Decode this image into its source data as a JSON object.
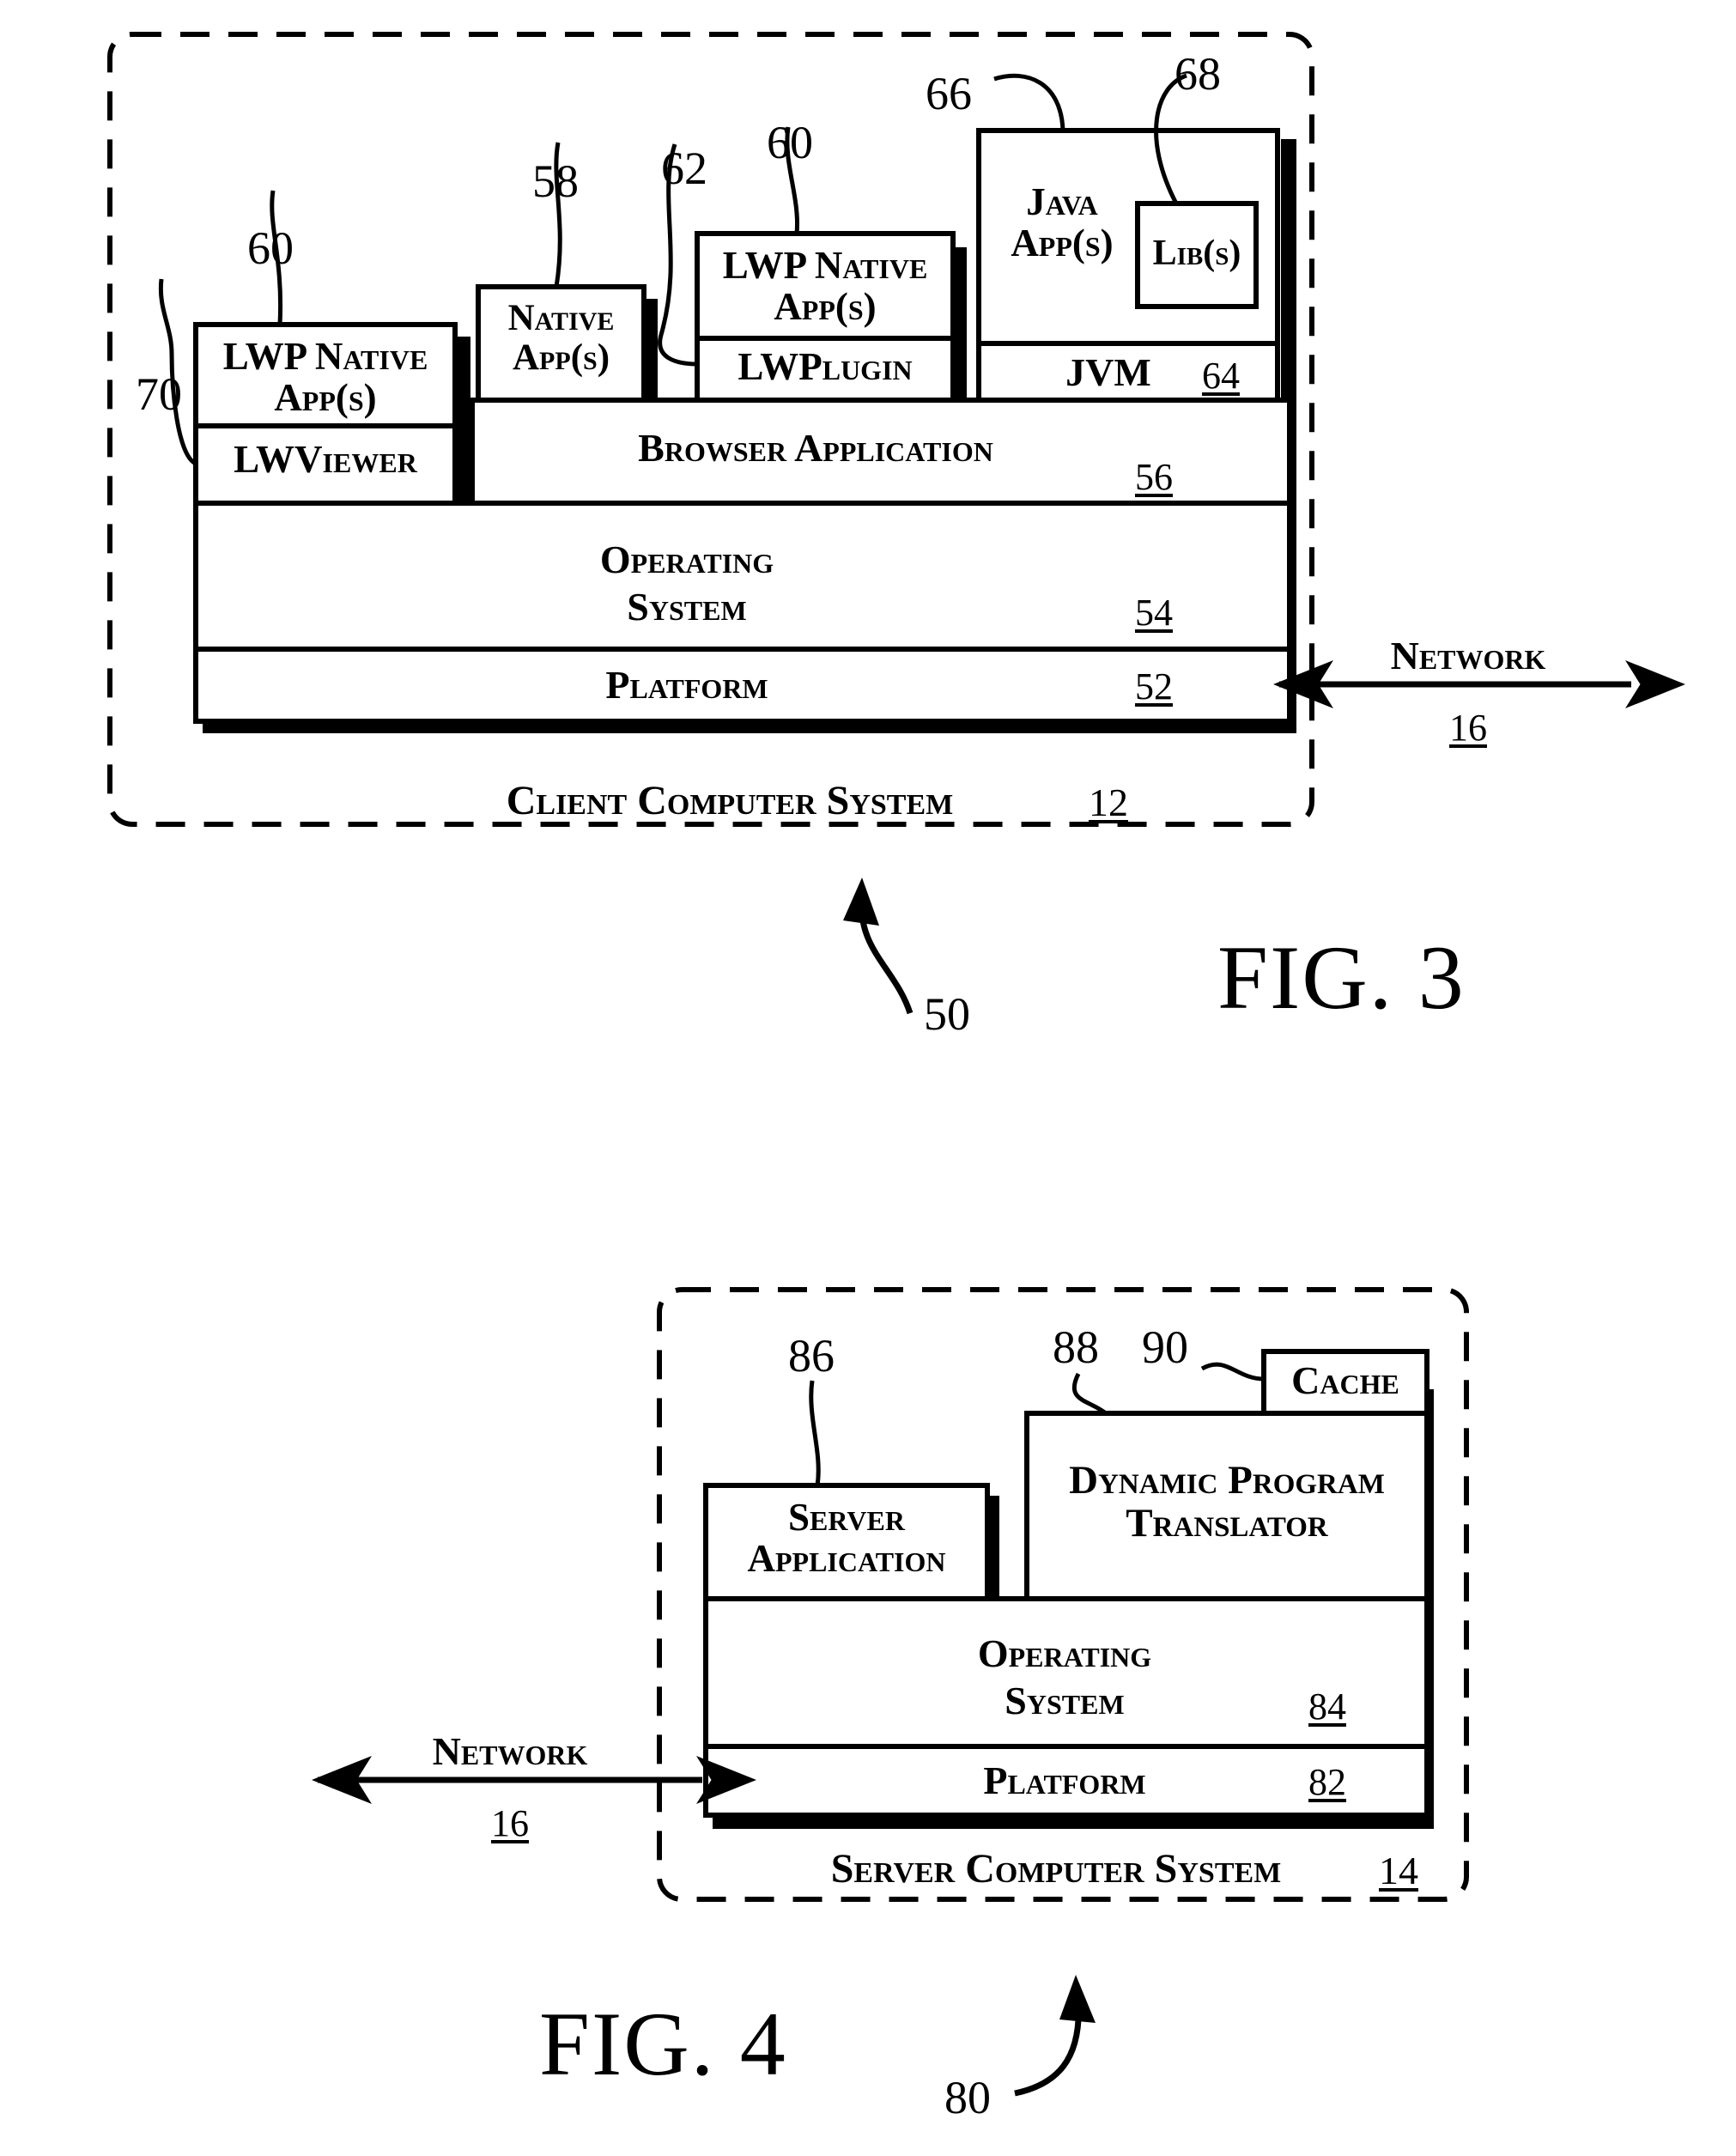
{
  "document": {
    "type": "patent-figure-sheet",
    "figures": [
      "FIG. 3",
      "FIG. 4"
    ]
  },
  "fig3": {
    "figure_label": "FIG. 3",
    "system_ref": "50",
    "enclosure_caption": "Client Computer System",
    "enclosure_ref": "12",
    "network": {
      "label": "Network",
      "ref": "16"
    },
    "blocks": {
      "lwp_native_app_left": {
        "label": "LWP Native\nApp(s)",
        "ref": "60"
      },
      "lwviewer": {
        "label": "LWViewer",
        "ref": "70"
      },
      "native_app": {
        "label": "Native\nApp(s)",
        "ref": "58"
      },
      "lwp_native_app_mid": {
        "label": "LWP Native\nApp(s)",
        "ref": "60"
      },
      "lwplugin": {
        "label": "LWPlugin",
        "ref": "62"
      },
      "java_app": {
        "label": "Java\nApp(s)",
        "ref": "66"
      },
      "libs": {
        "label": "Lib(s)",
        "ref": "68"
      },
      "jvm": {
        "label": "JVM",
        "ref": "64"
      },
      "browser_application": {
        "label": "Browser Application",
        "ref": "56"
      },
      "operating_system": {
        "label": "Operating\nSystem",
        "ref": "54"
      },
      "platform": {
        "label": "Platform",
        "ref": "52"
      }
    }
  },
  "fig4": {
    "figure_label": "FIG. 4",
    "system_ref": "80",
    "enclosure_caption": "Server Computer System",
    "enclosure_ref": "14",
    "network": {
      "label": "Network",
      "ref": "16"
    },
    "blocks": {
      "server_application": {
        "label": "Server\nApplication",
        "ref": "86"
      },
      "dynamic_program_translator": {
        "label": "Dynamic Program\nTranslator",
        "ref": "88"
      },
      "cache": {
        "label": "Cache",
        "ref": "90"
      },
      "operating_system": {
        "label": "Operating\nSystem",
        "ref": "84"
      },
      "platform": {
        "label": "Platform",
        "ref": "82"
      }
    }
  }
}
